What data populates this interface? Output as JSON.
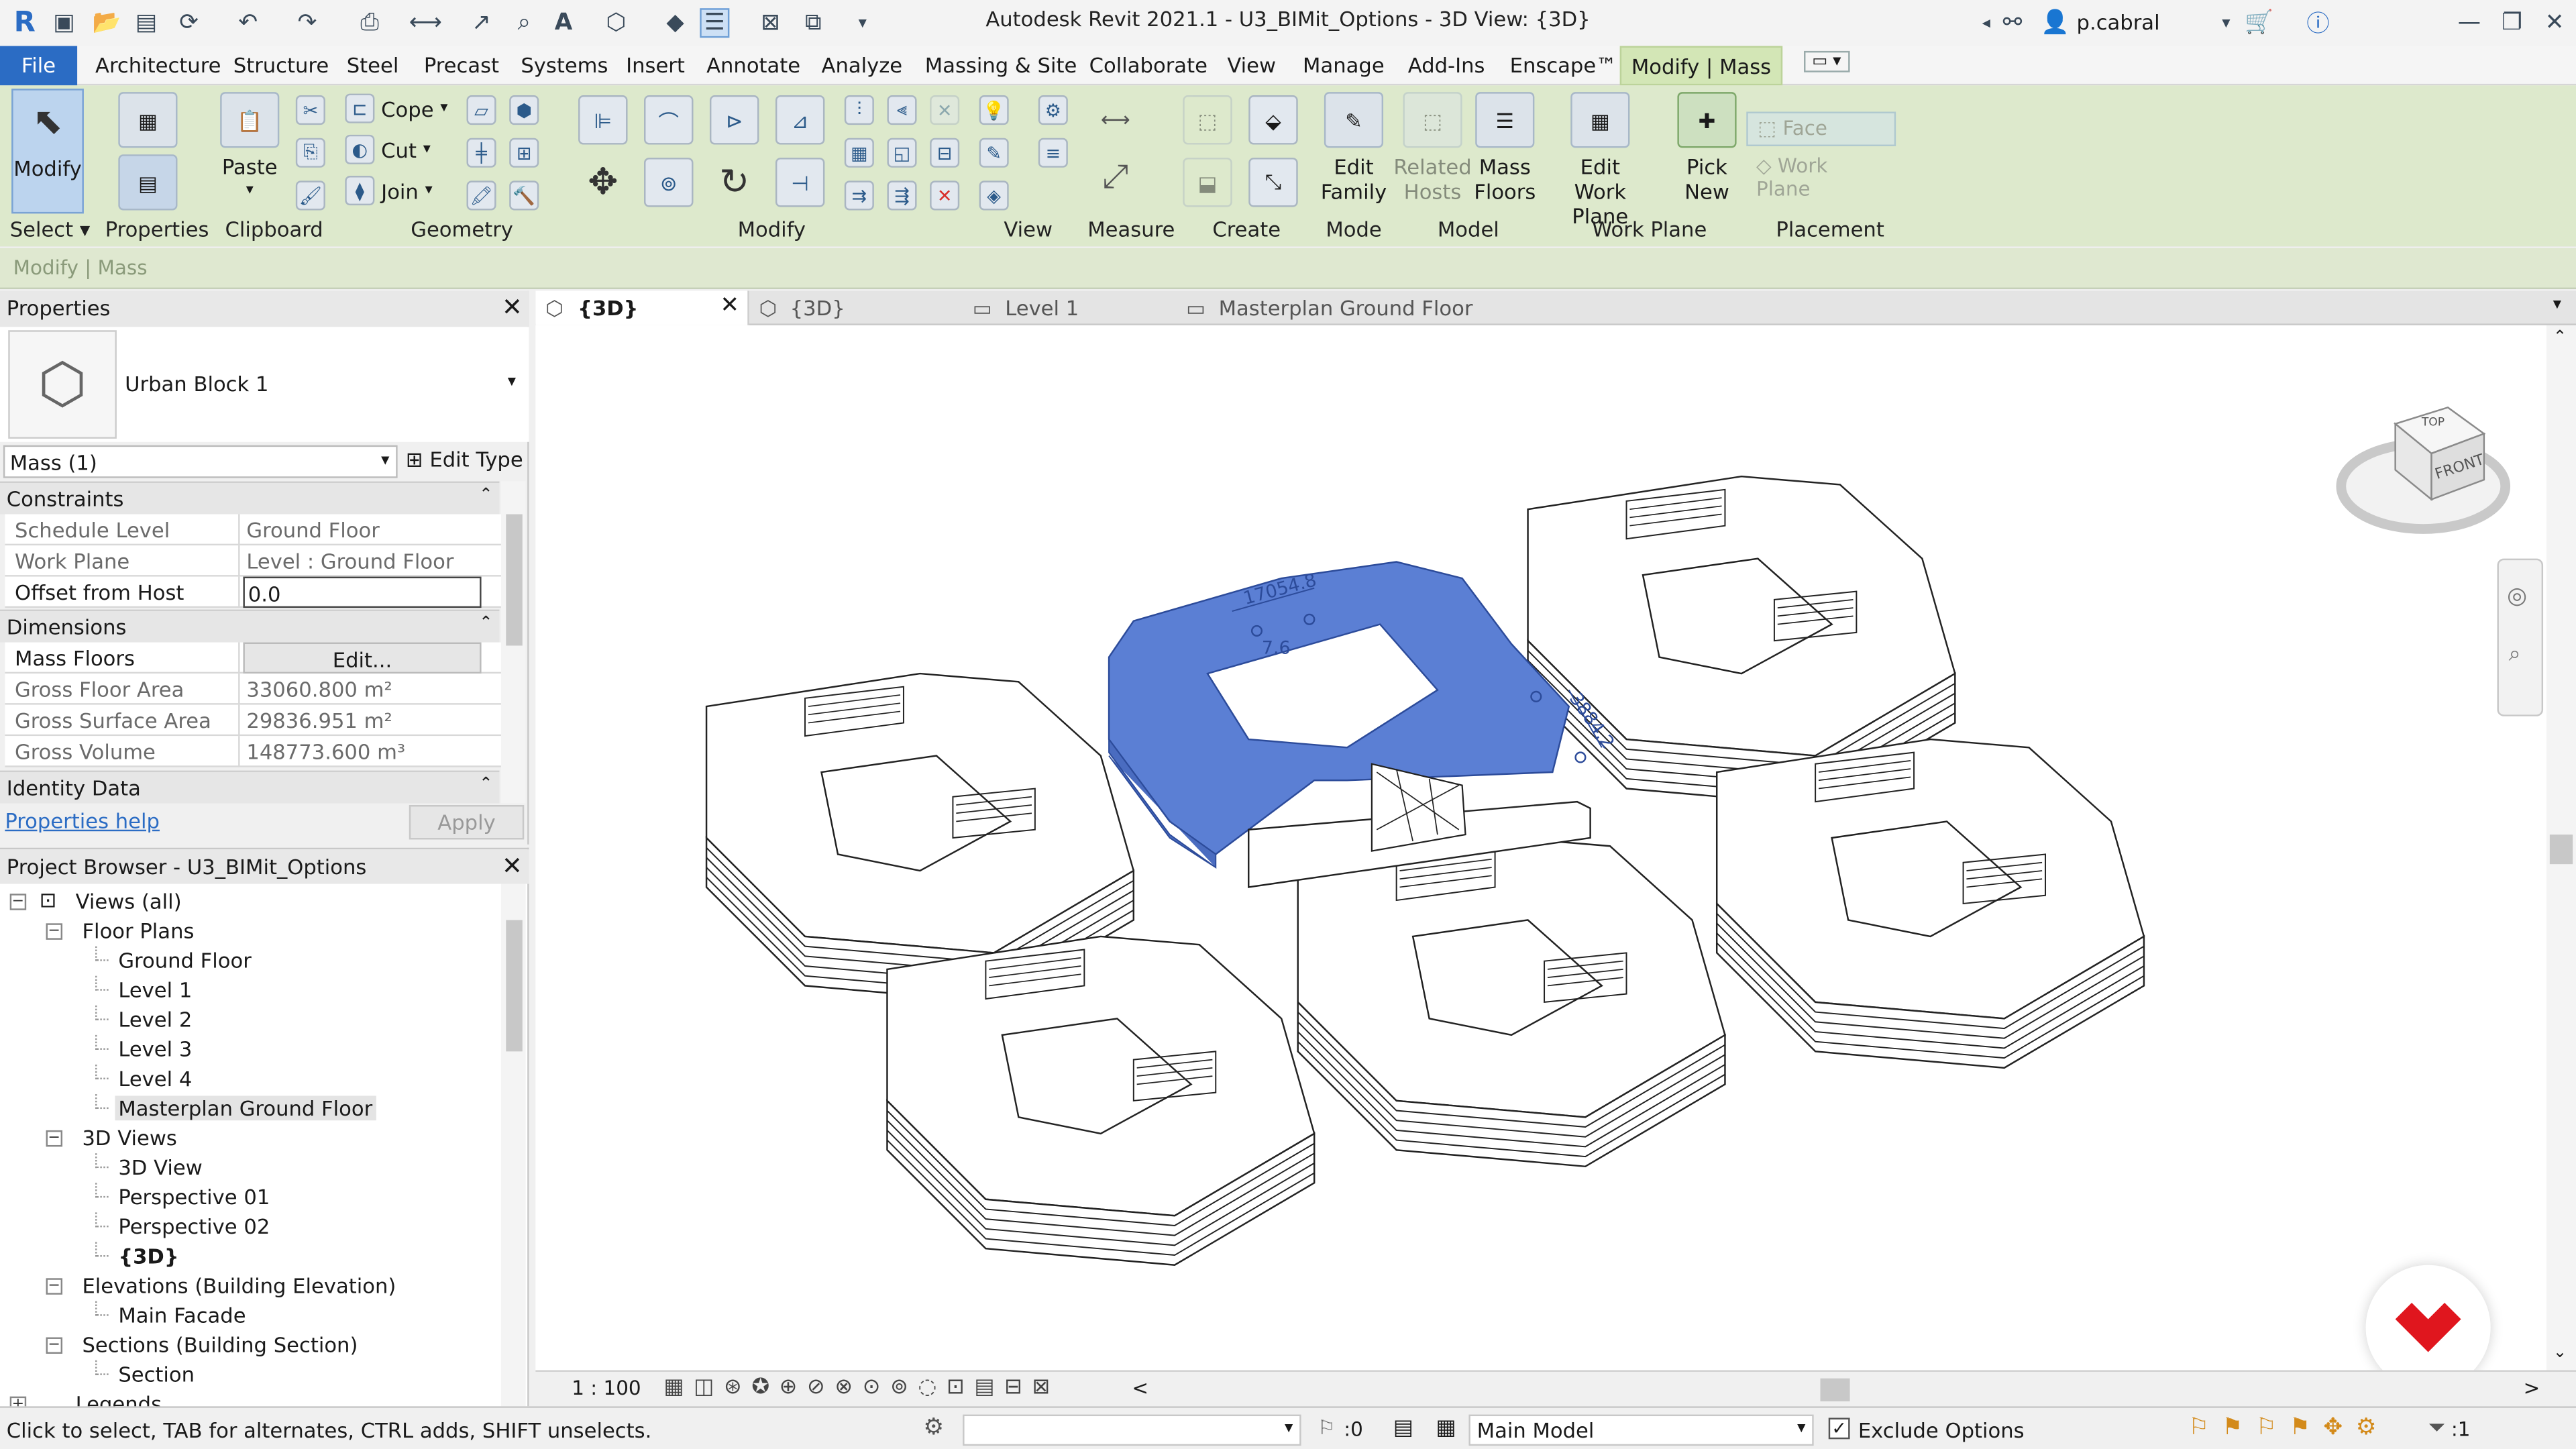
{
  "app": {
    "title": "Autodesk Revit 2021.1 - U3_BIMit_Options - 3D View: {3D}",
    "user": "p.cabral"
  },
  "menu": {
    "file": "File",
    "tabs": [
      "Architecture",
      "Structure",
      "Steel",
      "Precast",
      "Systems",
      "Insert",
      "Annotate",
      "Analyze",
      "Massing & Site",
      "Collaborate",
      "View",
      "Manage",
      "Add-Ins",
      "Enscape™"
    ],
    "active_tab": "Modify | Mass"
  },
  "ribbon": {
    "modify_btn": "Modify",
    "paste_btn": "Paste",
    "cope": "Cope",
    "cut": "Cut",
    "join": "Join",
    "edit_family": [
      "Edit",
      "Family"
    ],
    "related_hosts": [
      "Related",
      "Hosts"
    ],
    "mass_floors": [
      "Mass",
      "Floors"
    ],
    "edit_work_plane": [
      "Edit",
      "Work Plane"
    ],
    "pick_new": [
      "Pick",
      "New"
    ],
    "face": "Face",
    "work_plane": "Work Plane",
    "panels": {
      "select": "Select",
      "properties": "Properties",
      "clipboard": "Clipboard",
      "geometry": "Geometry",
      "modify": "Modify",
      "view": "View",
      "measure": "Measure",
      "create": "Create",
      "mode": "Mode",
      "model": "Model",
      "work_plane": "Work Plane",
      "placement": "Placement"
    }
  },
  "options_bar": {
    "text": "Modify | Mass"
  },
  "properties": {
    "title": "Properties",
    "type_name": "Urban Block 1",
    "filter": "Mass (1)",
    "edit_type": "Edit Type",
    "sections": {
      "constraints": "Constraints",
      "dimensions": "Dimensions",
      "identity": "Identity Data"
    },
    "rows": [
      {
        "key": "Schedule Level",
        "value": "Ground Floor"
      },
      {
        "key": "Work Plane",
        "value": "Level : Ground Floor"
      },
      {
        "key": "Offset from Host",
        "value": "0.0"
      },
      {
        "key": "Mass Floors",
        "value": "Edit..."
      },
      {
        "key": "Gross Floor Area",
        "value": "33060.800 m²"
      },
      {
        "key": "Gross Surface Area",
        "value": "29836.951 m²"
      },
      {
        "key": "Gross Volume",
        "value": "148773.600 m³"
      }
    ],
    "help_link": "Properties help",
    "apply": "Apply"
  },
  "browser": {
    "title": "Project Browser - U3_BIMit_Options",
    "items": [
      {
        "label": "Views (all)",
        "level": 0,
        "toggle": "−"
      },
      {
        "label": "Floor Plans",
        "level": 1,
        "toggle": "−"
      },
      {
        "label": "Ground Floor",
        "level": 2
      },
      {
        "label": "Level 1",
        "level": 2
      },
      {
        "label": "Level 2",
        "level": 2
      },
      {
        "label": "Level 3",
        "level": 2
      },
      {
        "label": "Level 4",
        "level": 2
      },
      {
        "label": "Masterplan Ground Floor",
        "level": 2,
        "selected": true
      },
      {
        "label": "3D Views",
        "level": 1,
        "toggle": "−"
      },
      {
        "label": "3D View",
        "level": 2
      },
      {
        "label": "Perspective 01",
        "level": 2
      },
      {
        "label": "Perspective 02",
        "level": 2
      },
      {
        "label": "{3D}",
        "level": 2,
        "bold": true
      },
      {
        "label": "Elevations (Building Elevation)",
        "level": 1,
        "toggle": "−"
      },
      {
        "label": "Main Facade",
        "level": 2
      },
      {
        "label": "Sections (Building Section)",
        "level": 1,
        "toggle": "−"
      },
      {
        "label": "Section",
        "level": 2
      },
      {
        "label": "Legends",
        "level": 0,
        "toggle": "+"
      }
    ]
  },
  "view_tabs": [
    "{3D}",
    "{3D}",
    "Level 1",
    "Masterplan Ground Floor"
  ],
  "viewport": {
    "dim_1": "17054.8",
    "dim_2": "7.6",
    "dim_3": "3884.2",
    "viewcube_top": "TOP",
    "viewcube_front": "FRONT",
    "scale": "1 : 100"
  },
  "status": {
    "hint": "Click to select, TAB for alternates, CTRL adds, SHIFT unselects.",
    "zero": ":0",
    "model": "Main Model",
    "exclude": "Exclude Options",
    "filter": ":1"
  },
  "colors": {
    "accent": "#2b6cc4",
    "context_tab": "#d3e6b6",
    "selection": "#5b7fd4"
  }
}
